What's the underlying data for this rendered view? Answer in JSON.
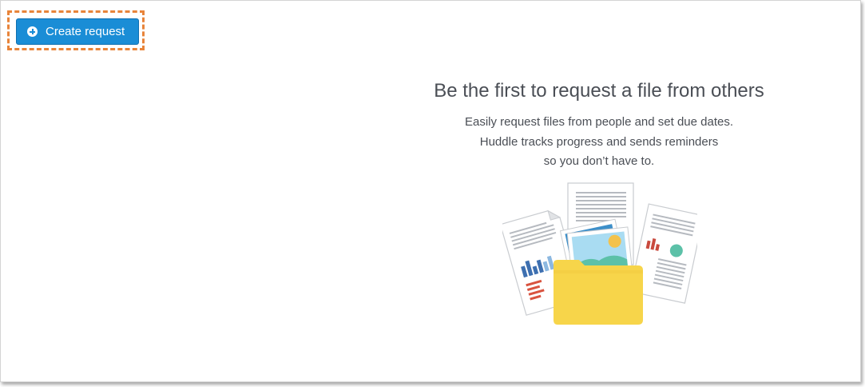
{
  "toolbar": {
    "create_label": "Create request",
    "create_icon": "plus-circle-icon"
  },
  "empty_state": {
    "title": "Be the first to request a file from others",
    "lines": [
      "Easily request files from people and set due dates.",
      "Huddle tracks progress and sends reminders",
      "so you don’t have to."
    ],
    "illustration": "documents-folder-illustration"
  },
  "colors": {
    "primary_button": "#1a8dd6",
    "highlight_outline": "#e8843a",
    "text": "#4a4e55",
    "folder": "#f7d54a"
  }
}
